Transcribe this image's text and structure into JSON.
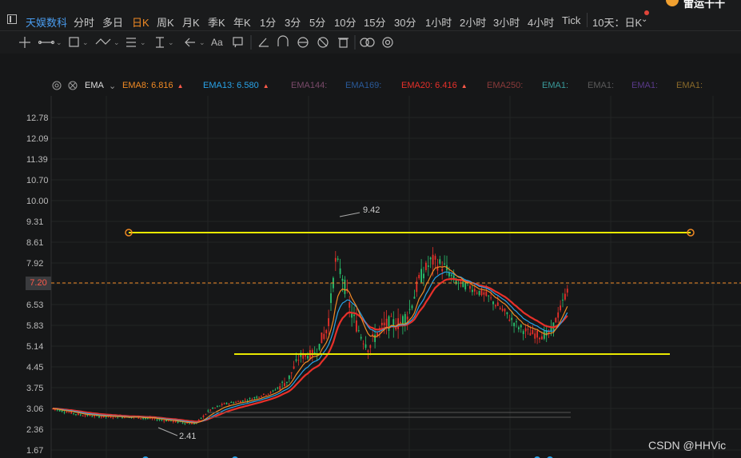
{
  "topbar": {
    "stock_name": "天娱数科",
    "timeframes": [
      "分时",
      "多日",
      "日K",
      "周K",
      "月K",
      "季K",
      "年K",
      "1分",
      "3分",
      "5分",
      "10分",
      "15分",
      "30分",
      "1小时",
      "2小时",
      "3小时",
      "4小时",
      "Tick"
    ],
    "active_timeframe": "日K",
    "period_selector": "10天：日K",
    "user_name": "雷运十十"
  },
  "toolbar": {
    "icons": [
      "crosshair-icon",
      "line-tool-icon",
      "rectangle-tool-icon",
      "pattern-tool-icon",
      "fib-tool-icon",
      "position-tool-icon",
      "arrow-tool-icon",
      "text-tool-icon",
      "comment-icon",
      "measure-icon",
      "magnet-icon",
      "lock-icon",
      "hide-icon",
      "delete-icon",
      "visibility-icon",
      "settings-icon"
    ]
  },
  "indicator": {
    "name": "EMA",
    "lines": [
      {
        "label": "EMA8:",
        "value": "6.816",
        "color": "#f08a24"
      },
      {
        "label": "EMA13:",
        "value": "6.580",
        "color": "#29a3e8"
      },
      {
        "label": "EMA144:",
        "value": "",
        "color": "#7a4a6a"
      },
      {
        "label": "EMA169:",
        "value": "",
        "color": "#2a5a9a"
      },
      {
        "label": "EMA20:",
        "value": "6.416",
        "color": "#e8302a"
      },
      {
        "label": "EMA250:",
        "value": "",
        "color": "#8a3a3a"
      },
      {
        "label": "EMA1:",
        "value": "",
        "color": "#3a9a9a"
      },
      {
        "label": "EMA1:",
        "value": "",
        "color": "#5a5a5a"
      },
      {
        "label": "EMA1:",
        "value": "",
        "color": "#5a3a8a"
      },
      {
        "label": "EMA1:",
        "value": "",
        "color": "#8a6a2a"
      }
    ]
  },
  "chart_data": {
    "type": "candlestick",
    "y_ticks": [
      "12.78",
      "12.09",
      "11.39",
      "10.70",
      "10.00",
      "9.31",
      "8.61",
      "7.92",
      "7.20",
      "6.53",
      "5.83",
      "5.14",
      "4.45",
      "3.75",
      "3.06",
      "2.36",
      "1.67"
    ],
    "current_price": "7.20",
    "annotations": [
      {
        "text": "9.42",
        "kind": "high"
      },
      {
        "text": "2.41",
        "kind": "low"
      }
    ],
    "horizontal_lines": [
      {
        "price": 8.9,
        "color": "#e8e800"
      },
      {
        "price": 4.8,
        "color": "#e8e800"
      }
    ]
  },
  "watermark": "CSDN @HHVic"
}
